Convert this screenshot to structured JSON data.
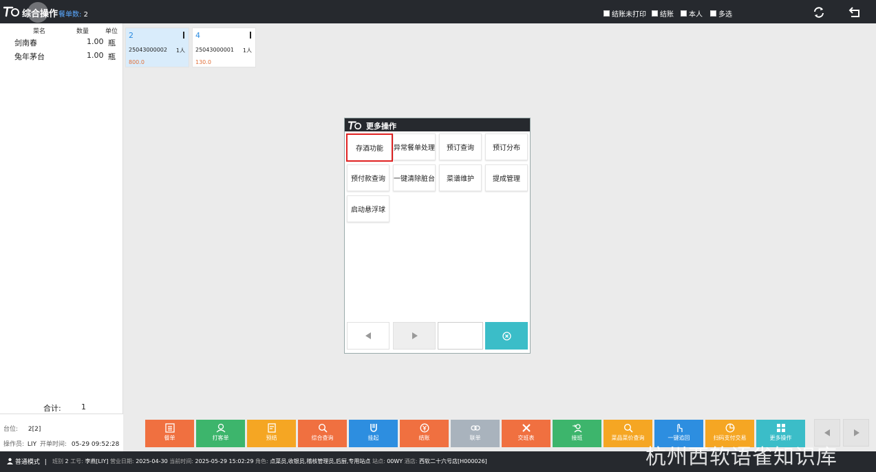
{
  "header": {
    "title": "综合操作",
    "order_count_label": "餐单数:",
    "order_count": "2",
    "checks": [
      "结账未打印",
      "结账",
      "本人",
      "多选"
    ]
  },
  "dish_list": {
    "columns": [
      "菜名",
      "数量",
      "单位"
    ],
    "rows": [
      {
        "name": "剑南春",
        "qty": "1.00",
        "unit": "瓶"
      },
      {
        "name": "兔年茅台",
        "qty": "1.00",
        "unit": "瓶"
      }
    ],
    "total_label": "合计:",
    "total_value": "1"
  },
  "info": {
    "table_label": "台位:",
    "table_value": "2[2]",
    "operator_label": "操作员:",
    "operator_value": "LIY",
    "open_time_label": "开单时间:",
    "open_time_value": "05-29 09:52:28"
  },
  "tables": [
    {
      "number": "2",
      "code": "25043000002",
      "people": "1人",
      "amount": "800.0"
    },
    {
      "number": "4",
      "code": "25043000001",
      "people": "1人",
      "amount": "130.0"
    }
  ],
  "dialog": {
    "title": "更多操作",
    "operations": [
      "存酒功能",
      "异常餐单处理",
      "预订查询",
      "预订分布",
      "预付款查询",
      "一键清除脏台",
      "菜谱维护",
      "提成管理",
      "启动悬浮球"
    ],
    "page_input_value": ""
  },
  "toolbar": [
    {
      "label": "餐单",
      "color": "#f07040"
    },
    {
      "label": "打客单",
      "color": "#3db56c"
    },
    {
      "label": "预结",
      "color": "#f5a623"
    },
    {
      "label": "综合查询",
      "color": "#f07040"
    },
    {
      "label": "挂起",
      "color": "#2d8ee0"
    },
    {
      "label": "结账",
      "color": "#f07040"
    },
    {
      "label": "联单",
      "color": "#a9b3bd"
    },
    {
      "label": "交班表",
      "color": "#f07040"
    },
    {
      "label": "接班",
      "color": "#3db56c"
    },
    {
      "label": "菜品菜价查询",
      "color": "#f5a623"
    },
    {
      "label": "一键追回",
      "color": "#2d8ee0"
    },
    {
      "label": "扫码支付交易",
      "color": "#f5a623"
    },
    {
      "label": "更多操作",
      "color": "#3bbdc8"
    }
  ],
  "status": {
    "mode": "普通模式",
    "shift_label": "班别",
    "shift_value": "2",
    "staff_label": "工号:",
    "staff_value": "李燕[LIY]",
    "bizdate_label": "营业日期:",
    "bizdate_value": "2025-04-30",
    "now_label": "当前时间:",
    "now_value": "2025-05-29 15:02:29",
    "role_label": "角色:",
    "role_value": "点菜员,收银员,稽核管理员,后厨,专用站点",
    "site_label": "站点:",
    "site_value": "00WY",
    "store_label": "酒店:",
    "store_value": "西软二十六号店[H000026]"
  },
  "watermark": "杭州西软语雀知识库"
}
